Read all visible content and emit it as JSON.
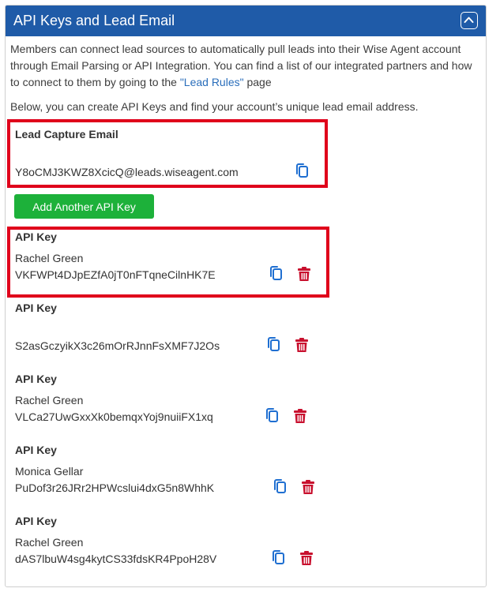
{
  "panel": {
    "title": "API Keys and Lead Email",
    "description_part1": "Members can connect lead sources to automatically pull leads into their Wise Agent account through Email Parsing or API Integration. You can find a list of our integrated partners and how to connect to them by going to the ",
    "lead_rules_link": "\"Lead Rules\"",
    "description_part2": " page",
    "description_line2": "Below, you can create API Keys and find your account’s unique lead email address."
  },
  "lead_capture": {
    "label": "Lead Capture Email",
    "email": "Y8oCMJ3KWZ8XcicQ@leads.wiseagent.com"
  },
  "add_button_label": "Add Another API Key",
  "api_keys": [
    {
      "label": "API Key",
      "name": "Rachel Green",
      "key": "VKFWPt4DJpEZfA0jT0nFTqneCilnHK7E"
    },
    {
      "label": "API Key",
      "name": "",
      "key": "S2asGczyikX3c26mOrRJnnFsXMF7J2Os"
    },
    {
      "label": "API Key",
      "name": "Rachel Green",
      "key": "VLCa27UwGxxXk0bemqxYoj9nuiiFX1xq"
    },
    {
      "label": "API Key",
      "name": "Monica Gellar",
      "key": "PuDof3r26JRr2HPWcslui4dxG5n8WhhK"
    },
    {
      "label": "API Key",
      "name": "Rachel Green",
      "key": "dAS7lbuW4sg4kytCS33fdsKR4PpoH28V"
    }
  ],
  "icons": {
    "copy": "copy-icon",
    "delete": "trash-icon",
    "collapse": "chevron-up-icon"
  },
  "colors": {
    "header": "#1f5ba8",
    "link": "#2a6ebb",
    "copy_icon": "#1f6fd1",
    "delete_icon": "#c8102e",
    "add_button": "#1db13a",
    "highlight": "#e0001b"
  }
}
